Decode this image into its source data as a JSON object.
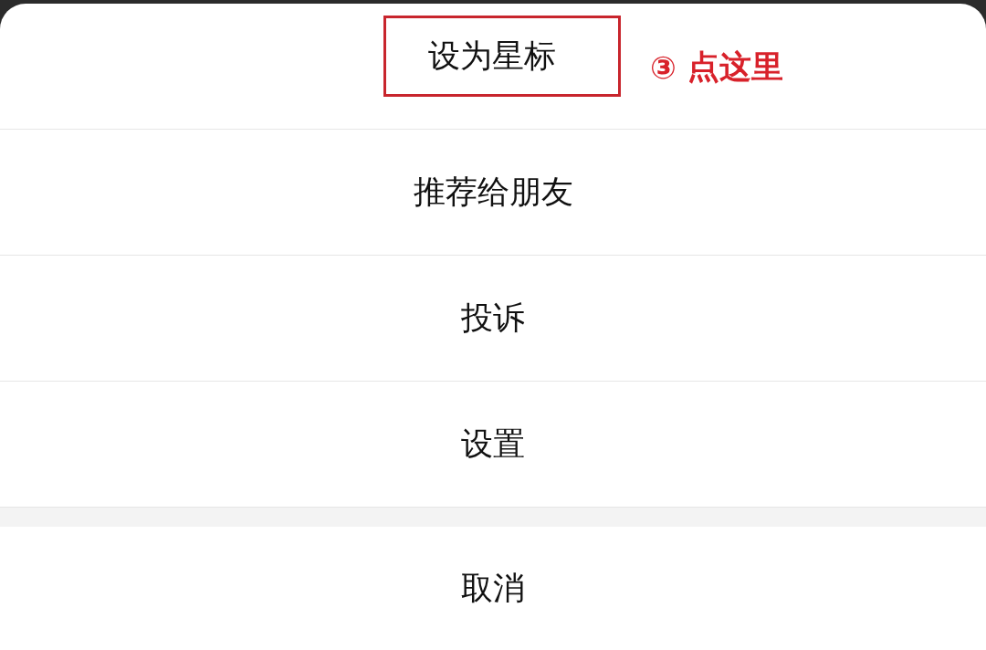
{
  "action_sheet": {
    "items": [
      {
        "label": "设为星标",
        "kind": "action",
        "highlighted": true
      },
      {
        "label": "推荐给朋友",
        "kind": "action",
        "highlighted": false
      },
      {
        "label": "投诉",
        "kind": "action",
        "highlighted": false
      },
      {
        "label": "设置",
        "kind": "action",
        "highlighted": false
      },
      {
        "label": "取消",
        "kind": "cancel",
        "highlighted": false
      }
    ]
  },
  "annotation": {
    "marker": "③",
    "text": "点这里"
  }
}
